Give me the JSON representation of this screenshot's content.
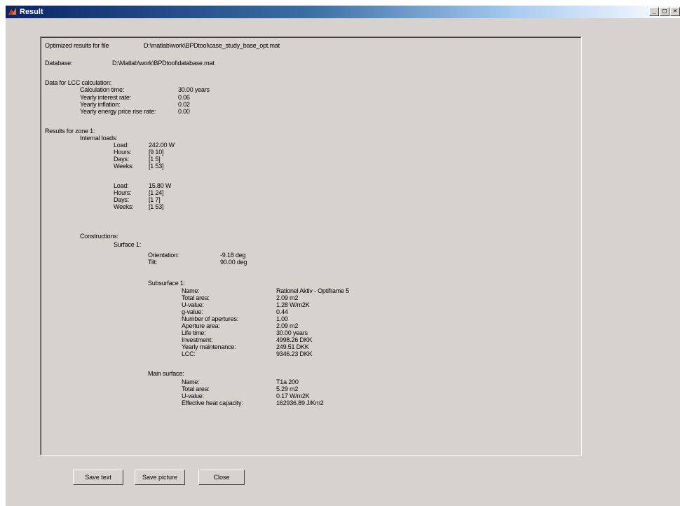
{
  "window": {
    "title": "Result"
  },
  "report": {
    "lines": [
      [
        "Optimized results for file",
        "D:\\matlab\\work\\BPDtool\\case_study_base_opt.mat"
      ],
      [
        "Database:",
        "D:\\Matlab\\work\\BPDtool\\database.mat"
      ],
      [
        "Data for LCC calculation:"
      ],
      [
        "Calculation time:",
        "30.00 years"
      ],
      [
        "Yearly interest rate:",
        "0.06"
      ],
      [
        "Yearly inflation:",
        "0.02"
      ],
      [
        "Yearly energy price rise rate:",
        "0.00"
      ],
      [
        "Results for zone 1:"
      ],
      [
        "Internal loads:"
      ],
      [
        "Load:",
        "242.00 W"
      ],
      [
        "Hours:",
        "[9 10]"
      ],
      [
        "Days:",
        "[1 5]"
      ],
      [
        "Weeks:",
        "[1 53]"
      ],
      [
        "Load:",
        "15.80 W"
      ],
      [
        "Hours:",
        "[1 24]"
      ],
      [
        "Days:",
        "[1 7]"
      ],
      [
        "Weeks:",
        "[1 53]"
      ],
      [
        "Constructions:"
      ],
      [
        "Surface 1:"
      ],
      [
        "Orientation:",
        "-9.18 deg"
      ],
      [
        "Tilt:",
        "90.00 deg"
      ],
      [
        "Subsurface 1:"
      ],
      [
        "Name:",
        "Rationel Aktiv - Optiframe 5"
      ],
      [
        "Total area:",
        "2.09 m2"
      ],
      [
        "U-value:",
        "1.28 W/m2K"
      ],
      [
        "g-value:",
        "0.44"
      ],
      [
        "Number of apertures:",
        "1.00"
      ],
      [
        "Aperture area:",
        "2.09 m2"
      ],
      [
        "Life time:",
        "30.00 years"
      ],
      [
        "Investment:",
        "4998.26 DKK"
      ],
      [
        "Yearly maintenance:",
        "249.51 DKK"
      ],
      [
        "LCC:",
        "9346.23 DKK"
      ],
      [
        "Main surface:"
      ],
      [
        "Name:",
        "T1a 200"
      ],
      [
        "Total area:",
        "5.29 m2"
      ],
      [
        "U-value:",
        "0.17 W/m2K"
      ],
      [
        "Effective heat capacity:",
        "162936.89 J/Km2"
      ]
    ]
  },
  "buttons": {
    "save_text": "Save text",
    "save_picture": "Save picture",
    "close": "Close"
  },
  "window_controls": {
    "minimize": "_",
    "maximize": "□",
    "close": "×"
  }
}
